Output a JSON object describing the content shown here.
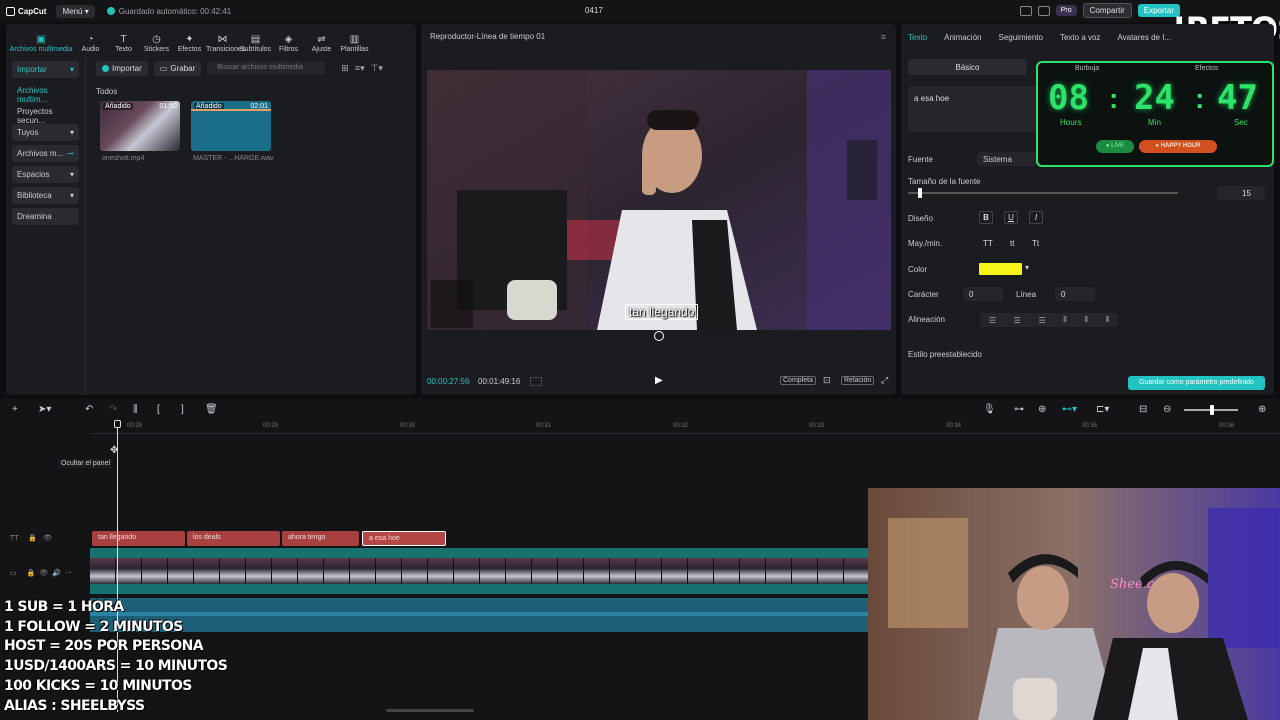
{
  "topbar": {
    "app_name": "CapCut",
    "menu_label": "Menú",
    "autosave_text": "Guardado automático: 00:42:41",
    "project_name": "0417",
    "pro_label": "Pro",
    "share_label": "Compartir",
    "export_label": "Exportar"
  },
  "overlay_title": "!RETOS",
  "tools": [
    {
      "label": "Archivos multimedia",
      "icon": "media-icon"
    },
    {
      "label": "Audio",
      "icon": "audio-icon"
    },
    {
      "label": "Texto",
      "icon": "text-icon"
    },
    {
      "label": "Stickers",
      "icon": "sticker-icon"
    },
    {
      "label": "Efectos",
      "icon": "effects-icon"
    },
    {
      "label": "Transiciones",
      "icon": "transitions-icon"
    },
    {
      "label": "Subtítulos",
      "icon": "subtitles-icon"
    },
    {
      "label": "Filtros",
      "icon": "filters-icon"
    },
    {
      "label": "Ajuste",
      "icon": "adjust-icon"
    },
    {
      "label": "Plantillas",
      "icon": "templates-icon"
    }
  ],
  "media_sidebar": {
    "items": [
      "Importar",
      "Archivos multim...",
      "Proyectos secun...",
      "Tuyos",
      "Archivos m...",
      "Espacios",
      "Biblioteca",
      "Dreamina"
    ]
  },
  "media": {
    "import_label": "Importar",
    "record_label": "Grabar",
    "search_placeholder": "Buscar archivos multimedia",
    "section_label": "Todos",
    "files": [
      {
        "badge": "Añadido",
        "duration": "01:50",
        "name": "oneshott.mp4"
      },
      {
        "badge": "Añadido",
        "duration": "02:01",
        "name": "MASTER - ...HARGE.wav"
      }
    ]
  },
  "player": {
    "title": "Reproductor-Línea de tiempo 01",
    "caption": "tan llegando",
    "current_time": "00:00:27:56",
    "total_time": "00:01:49:16",
    "btn_full": "Completa",
    "btn_ratio": "Relación"
  },
  "text_panel": {
    "tabs": [
      "Texto",
      "Animación",
      "Seguimiento",
      "Texto a voz",
      "Avatares de I..."
    ],
    "basic_label": "Básico",
    "text_value": "a esa hoe",
    "font_label": "Fuente",
    "font_value": "Sistema",
    "size_label": "Tamaño de la fuente",
    "size_value": "15",
    "design_label": "Diseño",
    "case_label": "May./min.",
    "case_opts": [
      "TT",
      "tt",
      "Tt"
    ],
    "color_label": "Color",
    "color_value": "#f5f51a",
    "char_label": "Carácter",
    "char_value": "0",
    "line_label": "Línea",
    "line_value": "0",
    "align_label": "Alineación",
    "preset_label": "Estilo preestablecido",
    "save_preset_label": "Guardar como parámetro predefinido"
  },
  "timer": {
    "tab_left": "Burbuja",
    "tab_right": "Efectos",
    "hours": "08",
    "minutes": "24",
    "seconds": "47",
    "hours_label": "Hours",
    "min_label": "Min",
    "sec_label": "Sec",
    "live_label": "● LIVE",
    "happy_label": "● HAPPY HOUR",
    "color": "#2de36a"
  },
  "timeline": {
    "ticks": [
      "00:28",
      "00:29",
      "00:30",
      "00:31",
      "00:32",
      "00:33",
      "00:34",
      "00:35",
      "00:36"
    ],
    "hide_panel_tooltip": "Ocultar el panel",
    "text_clips": [
      "tan llegando",
      "los deals",
      "ahora tengo",
      "a esa hoe"
    ]
  },
  "stream_rules": [
    "1 SUB = 1 HORA",
    "1 FOLLOW = 2 MINUTOS",
    "HOST = 20S POR PERSONA",
    "1USD/1400ARS = 10 MINUTOS",
    "100 KICKS = 10 MINUTOS",
    "ALIAS : SHEELBYSS"
  ],
  "accent_color": "#22c3c3"
}
